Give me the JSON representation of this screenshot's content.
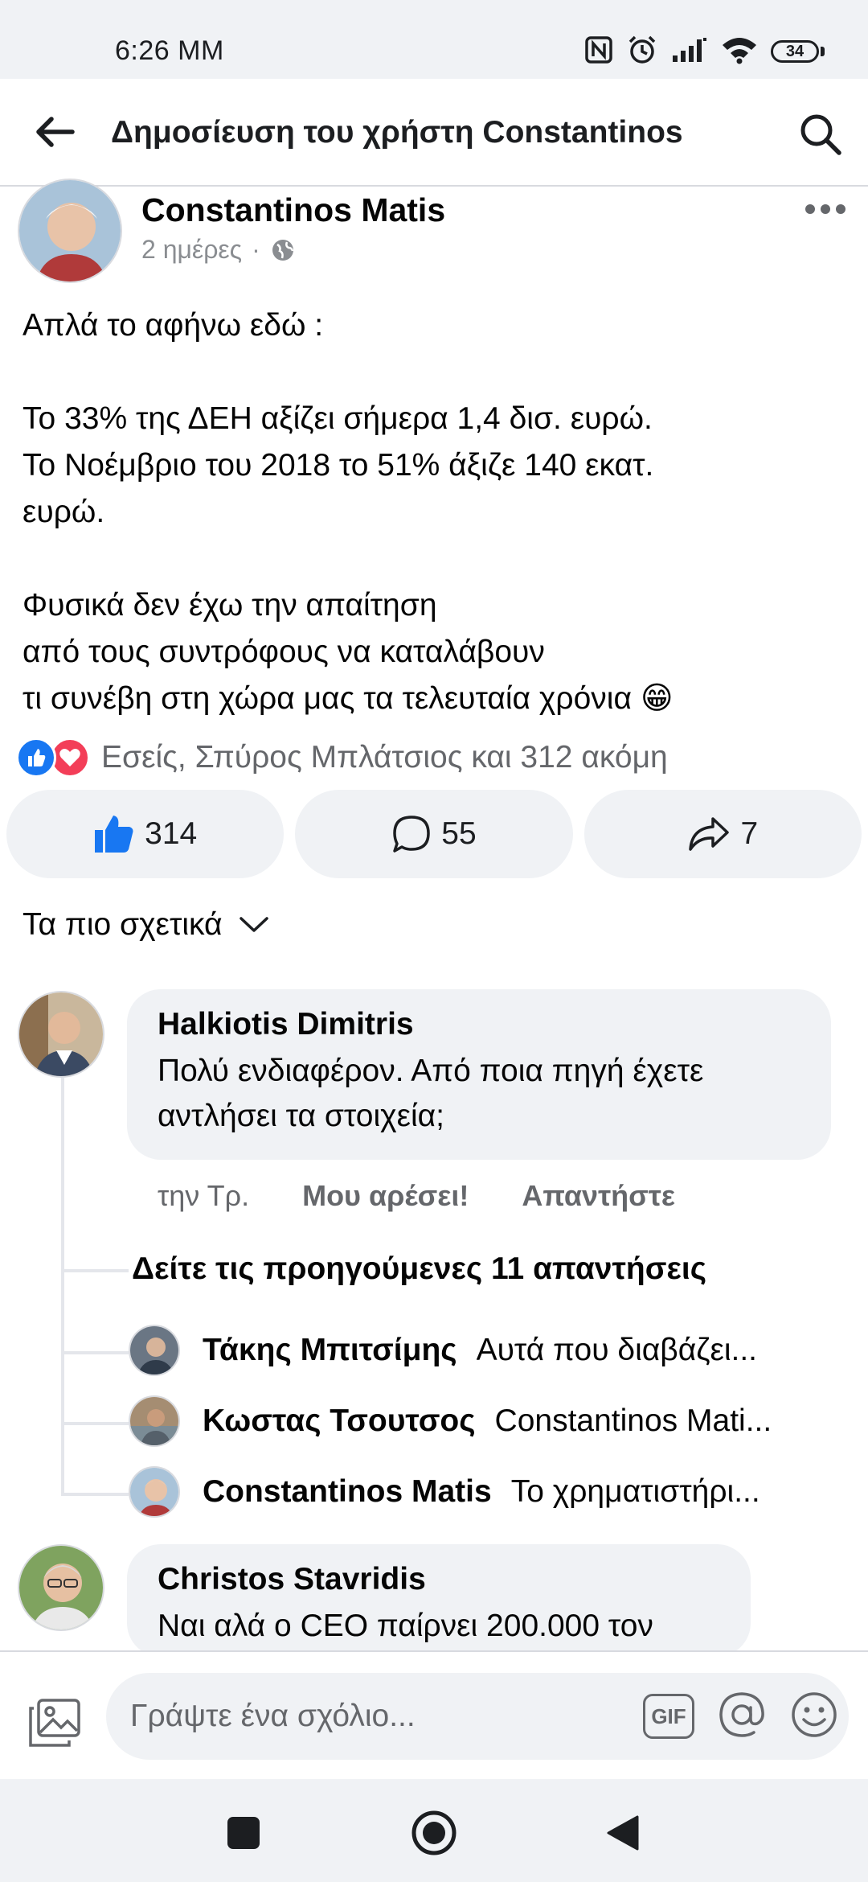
{
  "status_bar": {
    "time": "6:26 ΜΜ",
    "battery": "34"
  },
  "header": {
    "title": "Δημοσίευση του χρήστη Constantinos"
  },
  "post": {
    "author": "Constantinos Matis",
    "time": "2 ημέρες",
    "separator": "·",
    "audience_icon": "globe-icon",
    "lines": [
      "Απλά το αφήνω εδώ :",
      "",
      "Το 33% της ΔΕΗ αξίζει σήμερα 1,4 δισ. ευρώ.",
      "Το Νοέμβριο του 2018 το 51% άξιζε 140 εκατ.",
      "ευρώ.",
      "",
      "Φυσικά δεν έχω την απαίτηση",
      "από τους συντρόφους να καταλάβουν",
      "τι συνέβη στη χώρα μας τα τελευταία χρόνια  😁"
    ],
    "reactions_text": "Εσείς, Σπύρος Μπλάτσιος και 312 ακόμη",
    "like_count": "314",
    "comment_count": "55",
    "share_count": "7"
  },
  "sort": {
    "label": "Τα πιο σχετικά"
  },
  "comments": [
    {
      "author": "Halkiotis Dimitris",
      "text": "Πολύ ενδιαφέρον. Από ποια πηγή έχετε αντλήσει τα στοιχεία;",
      "time": "την Τρ.",
      "like_label": "Μου αρέσει!",
      "reply_label": "Απαντήστε",
      "more_replies": "Δείτε τις προηγούμενες 11 απαντήσεις",
      "replies": [
        {
          "author": "Τάκης Μπιτσίμης",
          "text": "Αυτά που διαβάζει..."
        },
        {
          "author": "Κωστας Τσουτσος",
          "text": "Constantinos Mati..."
        },
        {
          "author": "Constantinos Matis",
          "text": "Το χρηματιστήρι..."
        }
      ]
    },
    {
      "author": "Christos Stavridis",
      "text": "Ναι αλά ο CEO παίρνει 200.000 τον"
    }
  ],
  "composer": {
    "placeholder": "Γράψτε ένα σχόλιο...",
    "gif_label": "GIF"
  },
  "colors": {
    "facebook_blue": "#1877f2",
    "love_red": "#f33e58",
    "bubble_gray": "#f0f2f5",
    "secondary_text": "#65676b"
  }
}
